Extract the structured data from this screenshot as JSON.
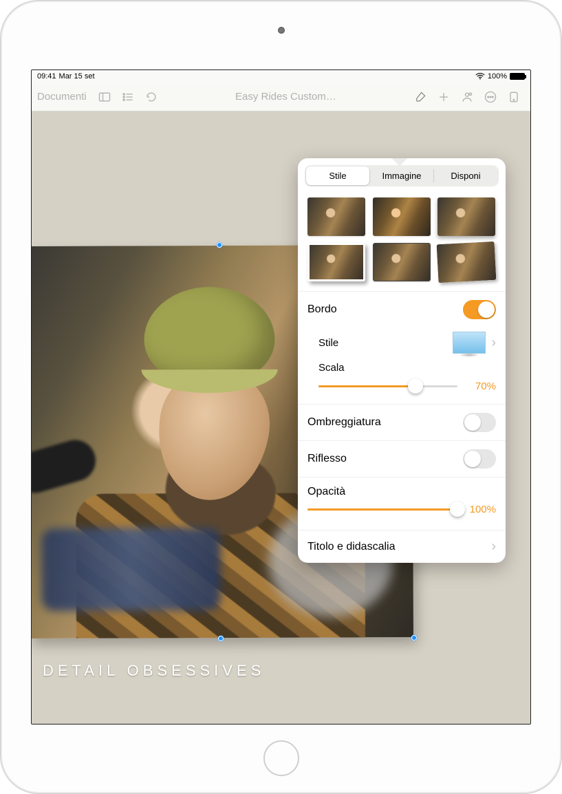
{
  "status": {
    "time": "09:41",
    "date": "Mar 15 set",
    "battery_pct": "100%"
  },
  "toolbar": {
    "documents_label": "Documenti",
    "title": "Easy Rides Custom…"
  },
  "canvas": {
    "caption": "DETAIL OBSESSIVES"
  },
  "popover": {
    "tabs": {
      "style": "Stile",
      "image": "Immagine",
      "arrange": "Disponi"
    },
    "border": {
      "label": "Bordo",
      "on": true,
      "style_label": "Stile",
      "scale_label": "Scala",
      "scale_value": "70%",
      "scale_pct": 70
    },
    "shadow": {
      "label": "Ombreggiatura",
      "on": false
    },
    "reflect": {
      "label": "Riflesso",
      "on": false
    },
    "opacity": {
      "label": "Opacità",
      "value": "100%",
      "pct": 100
    },
    "caption_row": "Titolo e didascalia"
  }
}
